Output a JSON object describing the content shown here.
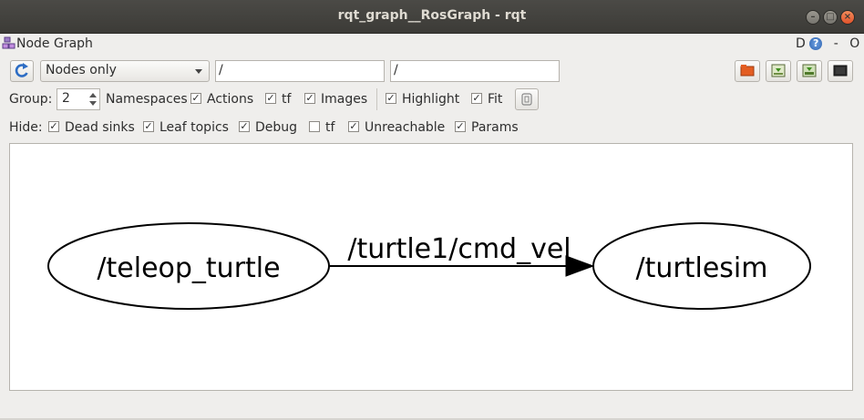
{
  "window": {
    "title": "rqt_graph__RosGraph - rqt"
  },
  "plugin": {
    "title": "Node Graph",
    "d_label": "D",
    "help_icon": "help-icon",
    "dash": "-",
    "o_label": "O"
  },
  "toolbar": {
    "refresh_icon": "refresh-icon",
    "mode_selected": "Nodes only",
    "filter_node": "/",
    "filter_topic": "/",
    "icons": [
      "open-folder-icon",
      "save-icon",
      "save-image-icon",
      "screenshot-icon"
    ]
  },
  "options": {
    "group_label": "Group:",
    "group_value": "2",
    "namespaces": "Namespaces",
    "actions": "Actions",
    "tf": "tf",
    "images": "Images",
    "highlight": "Highlight",
    "fit": "Fit"
  },
  "hide": {
    "label": "Hide:",
    "dead_sinks": "Dead sinks",
    "leaf_topics": "Leaf topics",
    "debug": "Debug",
    "tf": "tf",
    "unreachable": "Unreachable",
    "params": "Params"
  },
  "graph": {
    "nodes": [
      "/teleop_turtle",
      "/turtlesim"
    ],
    "edge_label": "/turtle1/cmd_vel"
  }
}
